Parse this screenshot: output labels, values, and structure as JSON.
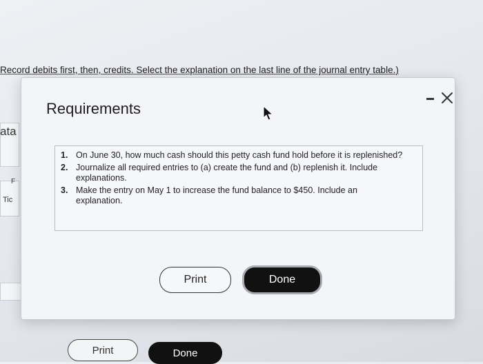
{
  "background": {
    "instruction": "Record debits first, then, credits. Select the explanation on the last line of the journal entry table.)",
    "side_label_data": "ata",
    "side_label_f": "F",
    "side_label_tic": "Tic",
    "print_label": "Print",
    "done_label": "Done"
  },
  "modal": {
    "title": "Requirements",
    "minimize_icon": "minimize-icon",
    "close_icon": "close-icon",
    "requirements": [
      {
        "num": "1.",
        "text": "On June 30, how much cash should this petty cash fund hold before it is replenished?"
      },
      {
        "num": "2.",
        "text": "Journalize all required entries to (a) create the fund and (b) replenish it. Include explanations."
      },
      {
        "num": "3.",
        "text": "Make the entry on May 1 to increase the fund balance to $450. Include an explanation."
      }
    ],
    "print_label": "Print",
    "done_label": "Done"
  },
  "colors": {
    "done_bg": "#111111",
    "modal_bg": "#f4f5f8"
  }
}
